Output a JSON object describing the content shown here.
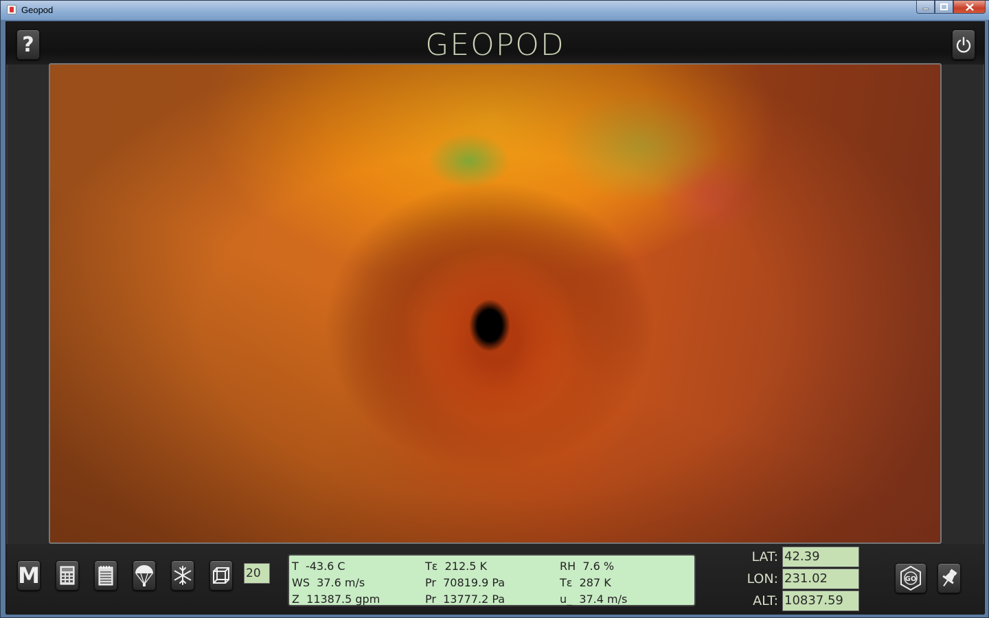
{
  "window": {
    "title": "Geopod"
  },
  "header": {
    "logo": "GEOPOD",
    "help_label": "?"
  },
  "toolbar": {
    "m_label": "M",
    "level_value": "20",
    "icons": [
      "calculator-icon",
      "notepad-icon",
      "parachute-icon",
      "snowflake-icon",
      "cube-icon"
    ]
  },
  "readout": {
    "rows": [
      [
        "T  -43.6 C",
        "Tε  212.5 K",
        "RH  7.6 %"
      ],
      [
        "WS  37.6 m/s",
        "Pr  70819.9 Pa",
        "Tε  287 K"
      ],
      [
        "Z  11387.5 gpm",
        "Pr  13777.2 Pa",
        "u_  37.4 m/s"
      ]
    ]
  },
  "coords": {
    "lat_label": "LAT:",
    "lat_value": "42.39",
    "lon_label": "LON:",
    "lon_value": "231.02",
    "alt_label": "ALT:",
    "alt_value": "10837.59"
  },
  "go": {
    "label": "GO"
  },
  "colors": {
    "readout_bg": "#c8ecc4",
    "field_bg": "#c6e0b4",
    "frame": "#2b2b2b"
  }
}
